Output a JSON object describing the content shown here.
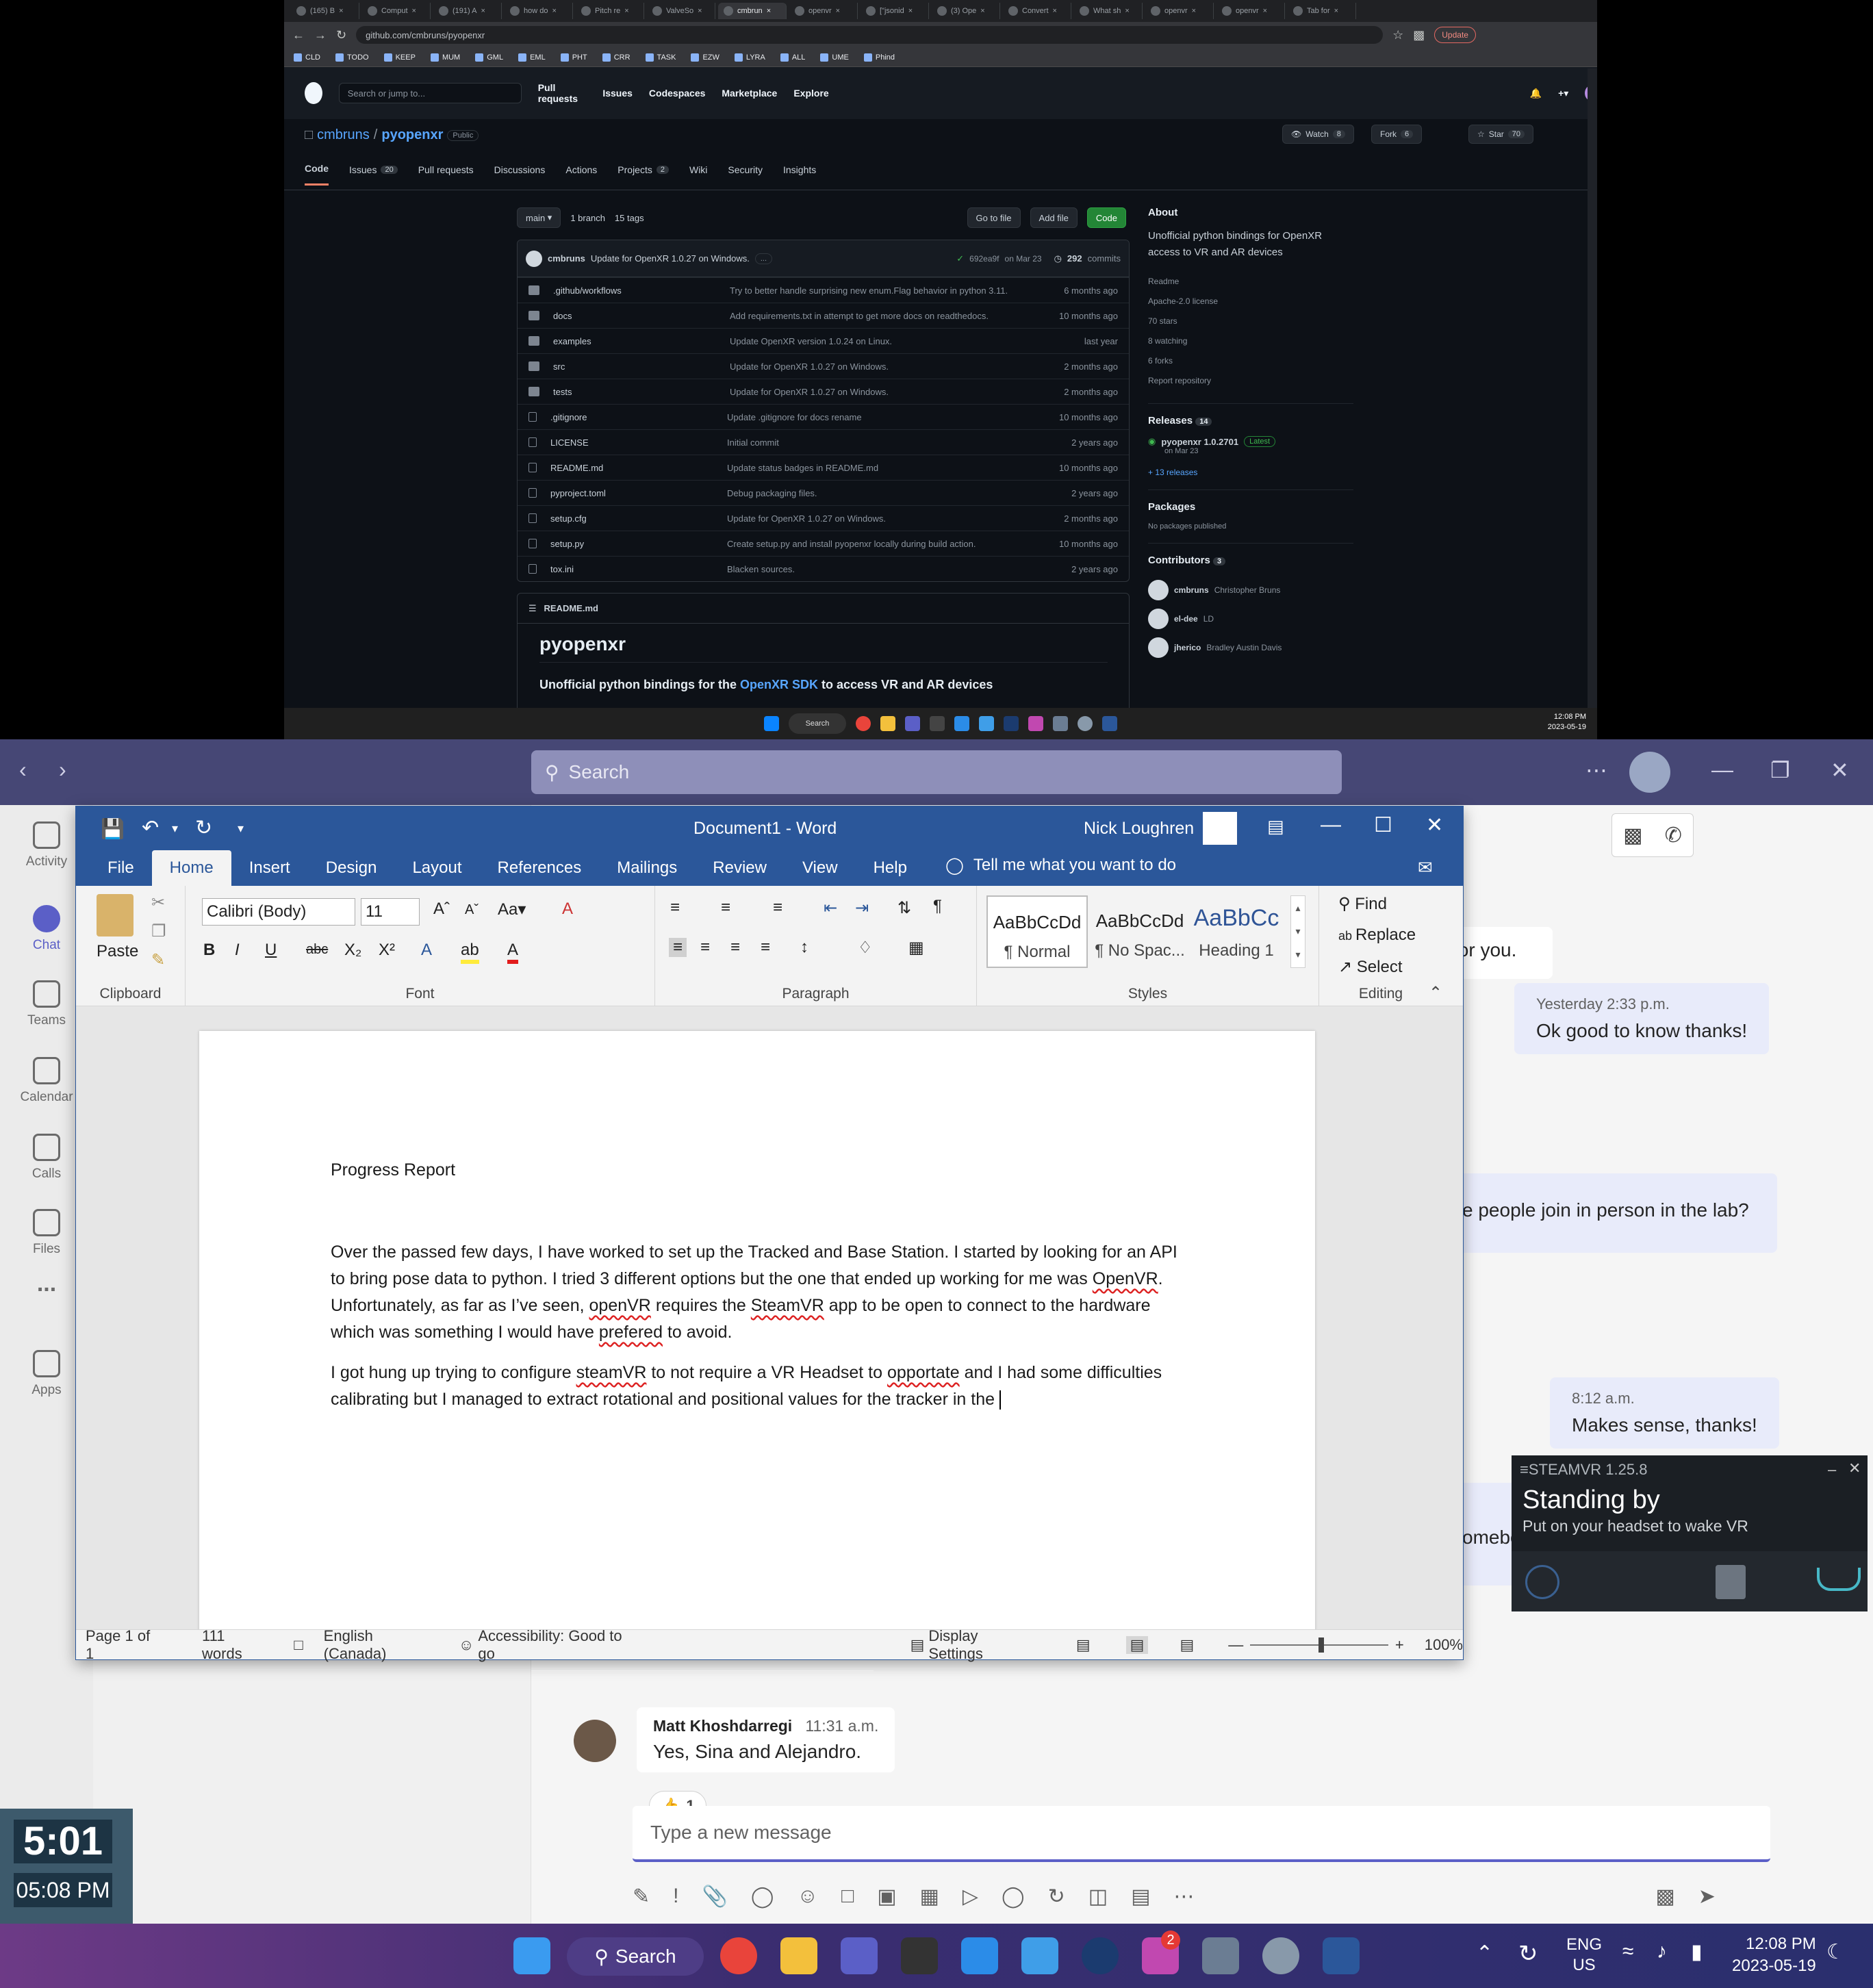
{
  "browser": {
    "tabs": [
      "(165) B",
      "Comput",
      "(191) A",
      "how do",
      "Pitch re",
      "ValveSo",
      "cmbrun",
      "openvr",
      "[\"jsonid",
      "(3) Ope",
      "Convert",
      "What sh",
      "openvr",
      "openvr",
      "Tab for"
    ],
    "url": "github.com/cmbruns/pyopenxr",
    "update_label": "Update",
    "bookmarks": [
      "CLD",
      "TODO",
      "KEEP",
      "MUM",
      "GML",
      "EML",
      "PHT",
      "CRR",
      "TASK",
      "EZW",
      "LYRA",
      "ALL",
      "UME",
      "Phind"
    ]
  },
  "github": {
    "search_placeholder": "Search or jump to...",
    "search_key": "/",
    "nav": [
      "Pull requests",
      "Issues",
      "Codespaces",
      "Marketplace",
      "Explore"
    ],
    "owner": "cmbruns",
    "repo": "pyopenxr",
    "visibility": "Public",
    "watch": {
      "label": "Watch",
      "count": "8"
    },
    "fork": {
      "label": "Fork",
      "count": "6"
    },
    "star": {
      "label": "Star",
      "count": "70"
    },
    "tabs": [
      {
        "label": "Code",
        "count": ""
      },
      {
        "label": "Issues",
        "count": "20"
      },
      {
        "label": "Pull requests",
        "count": ""
      },
      {
        "label": "Discussions",
        "count": ""
      },
      {
        "label": "Actions",
        "count": ""
      },
      {
        "label": "Projects",
        "count": "2"
      },
      {
        "label": "Wiki",
        "count": ""
      },
      {
        "label": "Security",
        "count": ""
      },
      {
        "label": "Insights",
        "count": ""
      }
    ],
    "branch": "main",
    "branches": "1 branch",
    "tags": "15 tags",
    "go_to_file": "Go to file",
    "add_file": "Add file",
    "code_btn": "Code",
    "commit": {
      "author": "cmbruns",
      "message": "Update for OpenXR 1.0.27 on Windows.",
      "ellipsis": "...",
      "hash": "692ea9f",
      "date": "on Mar 23",
      "count": "292",
      "count_label": "commits"
    },
    "files": [
      {
        "name": ".github/workflows",
        "type": "dir",
        "msg": "Try to better handle surprising new enum.Flag behavior in python 3.11.",
        "age": "6 months ago"
      },
      {
        "name": "docs",
        "type": "dir",
        "msg": "Add requirements.txt in attempt to get more docs on readthedocs.",
        "age": "10 months ago"
      },
      {
        "name": "examples",
        "type": "dir",
        "msg": "Update OpenXR version 1.0.24 on Linux.",
        "age": "last year"
      },
      {
        "name": "src",
        "type": "dir",
        "msg": "Update for OpenXR 1.0.27 on Windows.",
        "age": "2 months ago"
      },
      {
        "name": "tests",
        "type": "dir",
        "msg": "Update for OpenXR 1.0.27 on Windows.",
        "age": "2 months ago"
      },
      {
        "name": ".gitignore",
        "type": "file",
        "msg": "Update .gitignore for docs rename",
        "age": "10 months ago"
      },
      {
        "name": "LICENSE",
        "type": "file",
        "msg": "Initial commit",
        "age": "2 years ago"
      },
      {
        "name": "README.md",
        "type": "file",
        "msg": "Update status badges in README.md",
        "age": "10 months ago"
      },
      {
        "name": "pyproject.toml",
        "type": "file",
        "msg": "Debug packaging files.",
        "age": "2 years ago"
      },
      {
        "name": "setup.cfg",
        "type": "file",
        "msg": "Update for OpenXR 1.0.27 on Windows.",
        "age": "2 months ago"
      },
      {
        "name": "setup.py",
        "type": "file",
        "msg": "Create setup.py and install pyopenxr locally during build action.",
        "age": "10 months ago"
      },
      {
        "name": "tox.ini",
        "type": "file",
        "msg": "Blacken sources.",
        "age": "2 years ago"
      }
    ],
    "readme": {
      "header": "README.md",
      "title": "pyopenxr",
      "lead_pre": "Unofficial python bindings for the ",
      "lead_link": "OpenXR SDK",
      "lead_post": " to access VR and AR devices"
    },
    "about": {
      "title": "About",
      "description": "Unofficial python bindings for OpenXR access to VR and AR devices",
      "meta": [
        "Readme",
        "Apache-2.0 license",
        "70 stars",
        "8 watching",
        "6 forks",
        "Report repository"
      ],
      "releases_title": "Releases",
      "releases_count": "14",
      "release_name": "pyopenxr 1.0.2701",
      "release_badge": "Latest",
      "release_date": "on Mar 23",
      "more_releases": "+ 13 releases",
      "packages_title": "Packages",
      "packages_note": "No packages published",
      "contributors_title": "Contributors",
      "contributors_count": "3",
      "contributors": [
        {
          "login": "cmbruns",
          "name": "Christopher Bruns"
        },
        {
          "login": "el-dee",
          "name": "LD"
        },
        {
          "login": "jherico",
          "name": "Bradley Austin Davis"
        }
      ]
    }
  },
  "taskbar_top": {
    "search": "Search",
    "time": "12:08 PM",
    "date": "2023-05-19"
  },
  "teams": {
    "search_placeholder": "Search",
    "rail": [
      "Activity",
      "Chat",
      "Teams",
      "Calendar",
      "Calls",
      "Files",
      "...",
      "Apps"
    ],
    "messages": [
      {
        "text": "for you."
      },
      {
        "time": "Yesterday 2:33 p.m.",
        "text": "Ok good to know thanks!"
      },
      {
        "text": "e people join in person in the lab?"
      },
      {
        "time": "8:12 a.m.",
        "text": "Makes sense, thanks!"
      },
      {
        "text": "omebo"
      }
    ],
    "last_sender": "Matt Khoshdarregi",
    "last_time": "11:31 a.m.",
    "last_text": "Yes, Sina and Alejandro.",
    "reaction_count": "1",
    "composer_placeholder": "Type a new message"
  },
  "word": {
    "doc_title": "Document1  -  Word",
    "user": "Nick Loughren",
    "tabs": [
      "File",
      "Home",
      "Insert",
      "Design",
      "Layout",
      "References",
      "Mailings",
      "Review",
      "View",
      "Help"
    ],
    "tell_me": "Tell me what you want to do",
    "font": "Calibri (Body)",
    "size": "11",
    "groups": {
      "clipboard": "Clipboard",
      "font": "Font",
      "paragraph": "Paragraph",
      "styles": "Styles",
      "editing": "Editing"
    },
    "paste": "Paste",
    "styles": [
      {
        "preview": "AaBbCcDd",
        "name": "¶ Normal"
      },
      {
        "preview": "AaBbCcDd",
        "name": "¶ No Spac..."
      },
      {
        "preview": "AaBbCc",
        "name": "Heading 1"
      }
    ],
    "editing": [
      "Find",
      "Replace",
      "Select"
    ],
    "doc": {
      "heading": "Progress Report",
      "p1": [
        {
          "t": "Over the passed few days, I have worked to set up the Tracked and Base Station. I started by looking for an API to bring pose data to python. I tried 3 different options but the one that ended up working for me was ",
          "sq": false
        },
        {
          "t": "OpenVR",
          "sq": true
        },
        {
          "t": ". Unfortunately, as far as I’ve seen, ",
          "sq": false
        },
        {
          "t": "openVR",
          "sq": true
        },
        {
          "t": " requires the ",
          "sq": false
        },
        {
          "t": "SteamVR",
          "sq": true
        },
        {
          "t": " app to be open to connect to the hardware which was something I would have ",
          "sq": false
        },
        {
          "t": "prefered",
          "sq": true
        },
        {
          "t": " to avoid.",
          "sq": false
        }
      ],
      "p2": [
        {
          "t": "I got hung up trying to configure ",
          "sq": false
        },
        {
          "t": "steamVR",
          "sq": true
        },
        {
          "t": " to not require a VR Headset to ",
          "sq": false
        },
        {
          "t": "opportate",
          "sq": true
        },
        {
          "t": " and I had some difficulties calibrating but I managed to extract rotational and positional values for the tracker in the ",
          "sq": false
        }
      ]
    },
    "status": {
      "page": "Page 1 of 1",
      "words": "111 words",
      "lang": "English (Canada)",
      "access": "Accessibility: Good to go",
      "display": "Display Settings",
      "zoom": "100%"
    }
  },
  "steamvr": {
    "title": "STEAMVR 1.25.8",
    "heading": "Standing by",
    "sub": "Put on your headset to wake VR"
  },
  "clock_widget": {
    "timer": "5:01",
    "time": "05:08 PM"
  },
  "taskbar": {
    "search": "Search",
    "lang1": "ENG",
    "lang2": "US",
    "time": "12:08 PM",
    "date": "2023-05-19",
    "badge": "2"
  }
}
